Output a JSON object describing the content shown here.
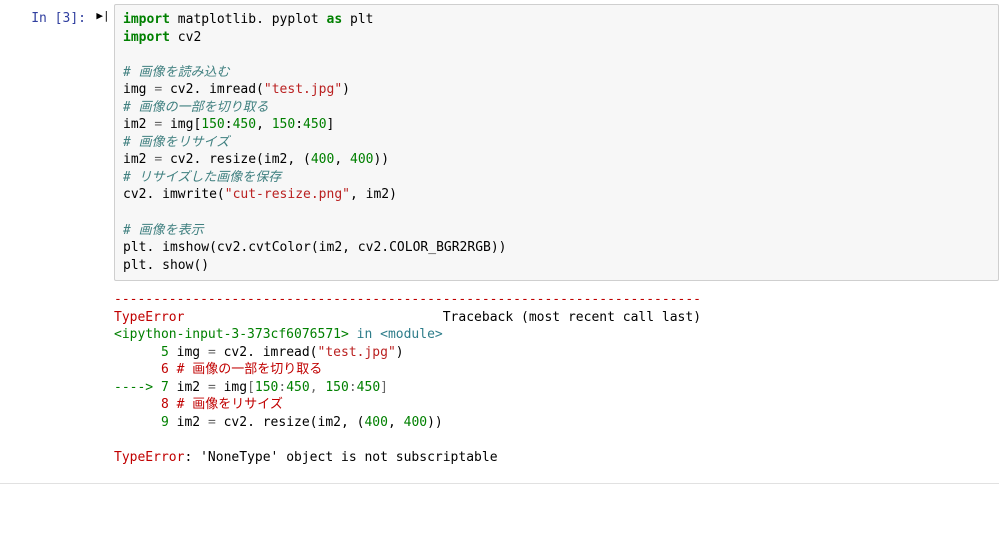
{
  "cell": {
    "prompt": "In [3]:",
    "run_icon": "▶|",
    "code_html": "<span class='kw'>import</span> <span class='nm'>matplotlib. pyplot</span> <span class='kw'>as</span> <span class='nm'>plt</span>\n<span class='kw'>import</span> <span class='nm'>cv2</span>\n\n<span class='cmt'># 画像を読み込む</span>\n<span class='nm'>img </span><span class='op'>=</span><span class='nm'> cv2. imread(</span><span class='str'>\"test.jpg\"</span><span class='nm'>)</span>\n<span class='cmt'># 画像の一部を切り取る</span>\n<span class='nm'>im2 </span><span class='op'>=</span><span class='nm'> img[</span><span class='num'>150</span><span class='nm'>:</span><span class='num'>450</span><span class='nm'>, </span><span class='num'>150</span><span class='nm'>:</span><span class='num'>450</span><span class='nm'>]</span>\n<span class='cmt'># 画像をリサイズ</span>\n<span class='nm'>im2 </span><span class='op'>=</span><span class='nm'> cv2. resize(im2, (</span><span class='num'>400</span><span class='nm'>, </span><span class='num'>400</span><span class='nm'>))</span>\n<span class='cmt'># リサイズした画像を保存</span>\n<span class='nm'>cv2. imwrite(</span><span class='str'>\"cut-resize.png\"</span><span class='nm'>, im2)</span>\n\n<span class='cmt'># 画像を表示</span>\n<span class='nm'>plt. imshow(cv2.cvtColor(im2, cv2.COLOR_BGR2RGB))</span>\n<span class='nm'>plt. show()</span>",
    "traceback_html": "<span class='tb-dash'>---------------------------------------------------------------------------</span>\n<span class='tb-err'>TypeError</span>                                 <span class='tb-trc'>Traceback (most recent call last)</span>\n<span class='tb-file'>&lt;ipython-input-3-373cf6076571&gt;</span> <span class='tb-in'>in</span> <span class='tb-mod'>&lt;module&gt;</span>\n<span class='tb-numln'>      5 </span><span class='tb-plain'>img </span><span class='op'>=</span><span class='tb-plain'> cv2. imread(</span><span class='str'>\"test.jpg\"</span><span class='tb-plain'>)</span>\n<span class='tb-cmtln'>      6 # 画像の一部を切り取る</span>\n<span class='tb-arrow'>----&gt; 7 </span><span class='tb-plain'>im2 </span><span class='op'>=</span><span class='tb-plain'> img</span><span class='op'>[</span><span class='num'>150</span><span class='op'>:</span><span class='num'>450</span><span class='op'>,</span><span class='tb-plain'> </span><span class='num'>150</span><span class='op'>:</span><span class='num'>450</span><span class='op'>]</span>\n<span class='tb-cmtln'>      8 # 画像をリサイズ</span>\n<span class='tb-numln'>      9 </span><span class='tb-plain'>im2 </span><span class='op'>=</span><span class='tb-plain'> cv2. resize(im2, (</span><span class='num'>400</span><span class='tb-plain'>, </span><span class='num'>400</span><span class='tb-plain'>))</span>\n\n<span class='tb-err'>TypeError</span><span class='tb-plain'>: 'NoneType' object is not subscriptable</span>"
  }
}
